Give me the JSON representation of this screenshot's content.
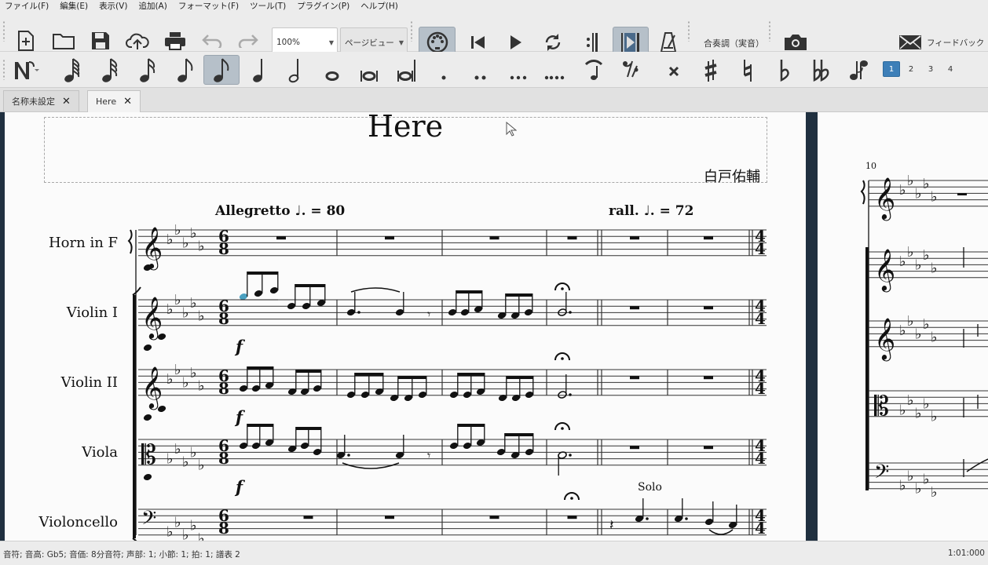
{
  "menu": [
    "ファイル(F)",
    "編集(E)",
    "表示(V)",
    "追加(A)",
    "フォーマット(F)",
    "ツール(T)",
    "プラグイン(P)",
    "ヘルプ(H)"
  ],
  "toolbar": {
    "zoom": "100%",
    "view_mode": "ページビュー",
    "concert_pitch": "合奏調（実音）",
    "feedback": "フィードバック"
  },
  "voices": [
    "1",
    "2",
    "3",
    "4"
  ],
  "tabs": [
    {
      "label": "名称未設定",
      "active": false
    },
    {
      "label": "Here",
      "active": true
    }
  ],
  "score": {
    "title": "Here",
    "composer": "白戸佑輔",
    "tempo_text": "Allegretto",
    "tempo_value": "= 80",
    "rall_text": "rall.",
    "rall_value": "= 72",
    "time_sig_top": "6",
    "time_sig_bottom": "8",
    "next_time_top": "4",
    "next_time_bottom": "4",
    "dynamic": "f",
    "solo": "Solo",
    "measure_number": "10",
    "instruments": [
      "Horn in F",
      "Violin I",
      "Violin II",
      "Viola",
      "Violoncello"
    ]
  },
  "status": {
    "left": "音符; 音高: Gb5; 音価: 8分音符; 声部: 1;  小節: 1; 拍: 1; 譜表 2",
    "right": "1:01:000"
  },
  "colors": {
    "selected_note": "#4aa0c0",
    "active_button": "#b6c0c9",
    "voice_active": "#3d7fb8",
    "page_bg": "#203040"
  }
}
